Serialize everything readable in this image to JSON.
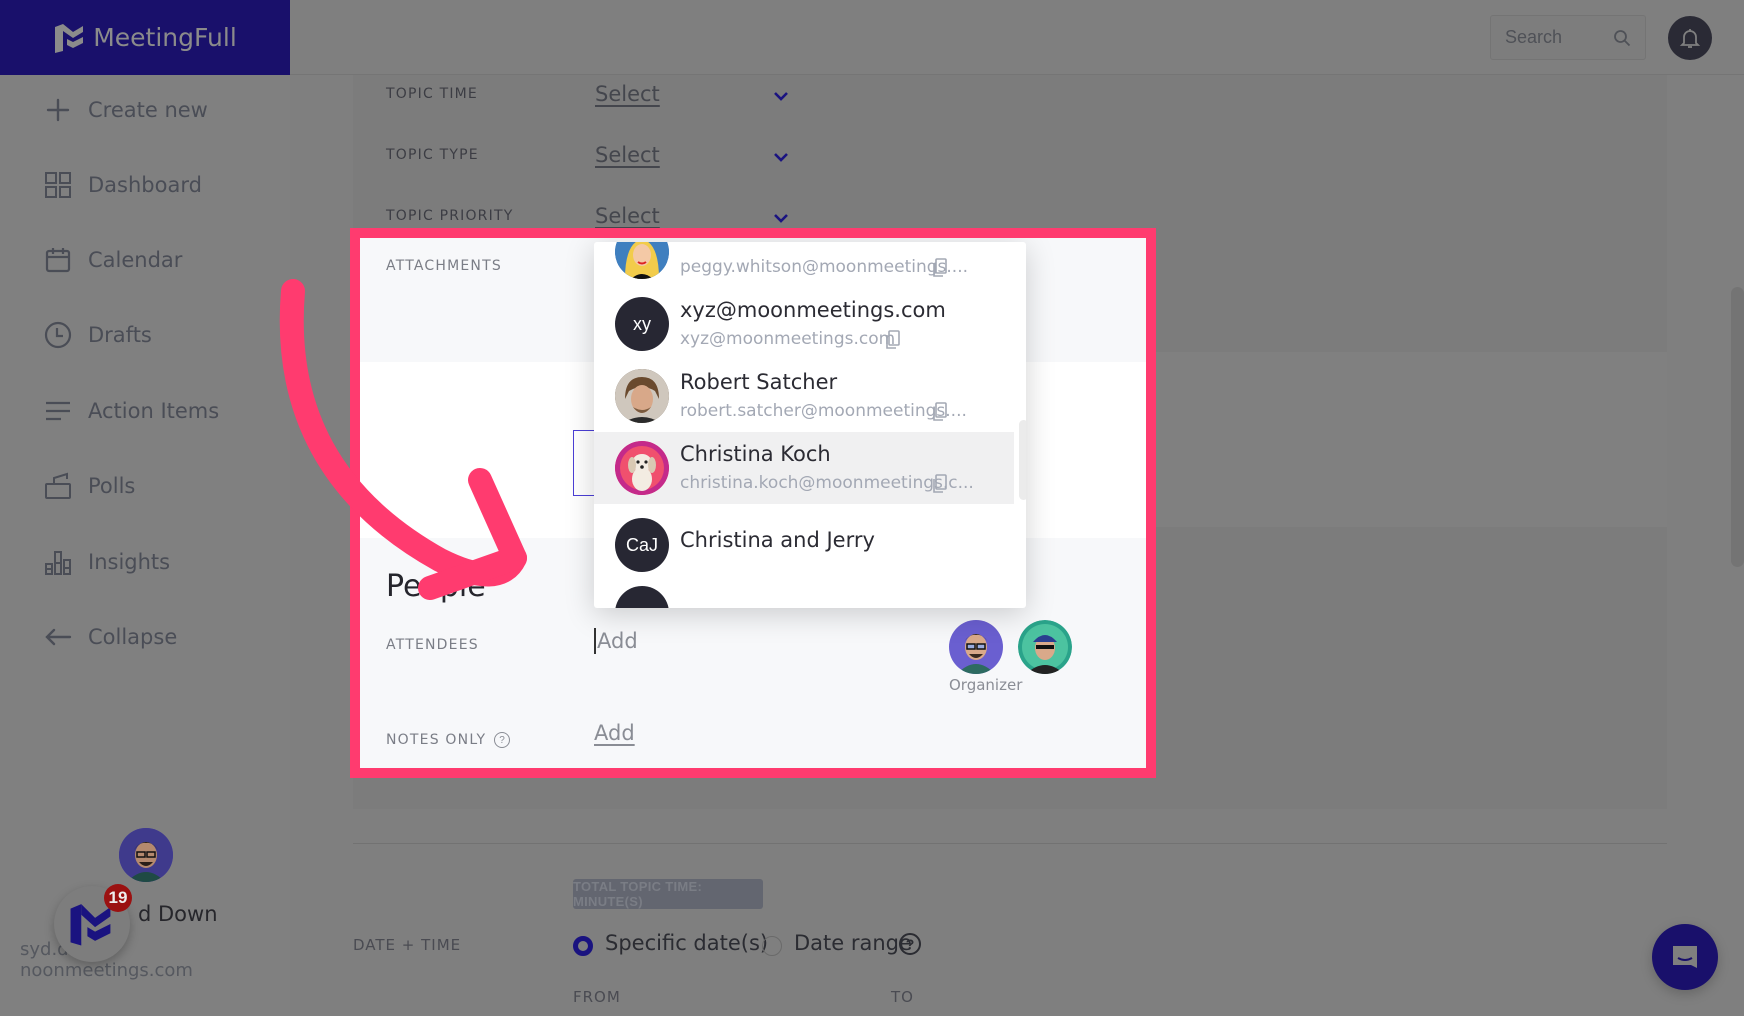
{
  "app": {
    "brand_name": "MeetingFull"
  },
  "sidebar": {
    "items": [
      {
        "label": "Create new",
        "icon": "plus-icon"
      },
      {
        "label": "Dashboard",
        "icon": "grid-icon"
      },
      {
        "label": "Calendar",
        "icon": "calendar-icon"
      },
      {
        "label": "Drafts",
        "icon": "clock-icon"
      },
      {
        "label": "Action Items",
        "icon": "list-icon"
      },
      {
        "label": "Polls",
        "icon": "ballot-box-icon"
      },
      {
        "label": "Insights",
        "icon": "bar-chart-icon"
      },
      {
        "label": "Collapse",
        "icon": "arrow-left-icon"
      }
    ],
    "user": {
      "name_visible": "d Down",
      "email_visible_start": "syd.d",
      "email_visible_end": "noonmeetings.com"
    },
    "launcher_badge": "19"
  },
  "header": {
    "search_placeholder": "Search"
  },
  "form": {
    "topic_time": {
      "label": "TOPIC TIME",
      "value": "Select"
    },
    "topic_type": {
      "label": "TOPIC TYPE",
      "value": "Select"
    },
    "topic_priority": {
      "label": "TOPIC PRIORITY",
      "value": "Select"
    },
    "attachments_label": "ATTACHMENTS",
    "people_title": "People",
    "attendees": {
      "label": "ATTENDEES",
      "placeholder": "Add"
    },
    "notes_only": {
      "label": "NOTES ONLY",
      "link": "Add",
      "help": "?"
    },
    "organizer_label": "Organizer",
    "total_topic_time": "TOTAL TOPIC TIME: MINUTE(S)",
    "date_time": {
      "label": "DATE + TIME",
      "options": [
        {
          "label": "Specific date(s)",
          "selected": true
        },
        {
          "label": "Date range",
          "selected": false
        }
      ],
      "help": "?",
      "from_label": "FROM",
      "to_label": "TO"
    }
  },
  "dropdown": {
    "items": [
      {
        "name": "",
        "email": "peggy.whitson@moonmeetings....",
        "initials": "",
        "avatar": "photo"
      },
      {
        "name": "xyz@moonmeetings.com",
        "email": "xyz@moonmeetings.com",
        "initials": "xy",
        "avatar": "initials"
      },
      {
        "name": "Robert Satcher",
        "email": "robert.satcher@moonmeetings....",
        "initials": "",
        "avatar": "photo"
      },
      {
        "name": "Christina Koch",
        "email": "christina.koch@moonmeetings.c...",
        "initials": "",
        "avatar": "photo",
        "highlighted": true
      },
      {
        "name": "Christina and Jerry",
        "email": "",
        "initials": "CaJ",
        "avatar": "initials"
      }
    ]
  },
  "colors": {
    "brand": "#19106b",
    "highlight": "#ff3b6f",
    "badge": "#9b1111"
  }
}
